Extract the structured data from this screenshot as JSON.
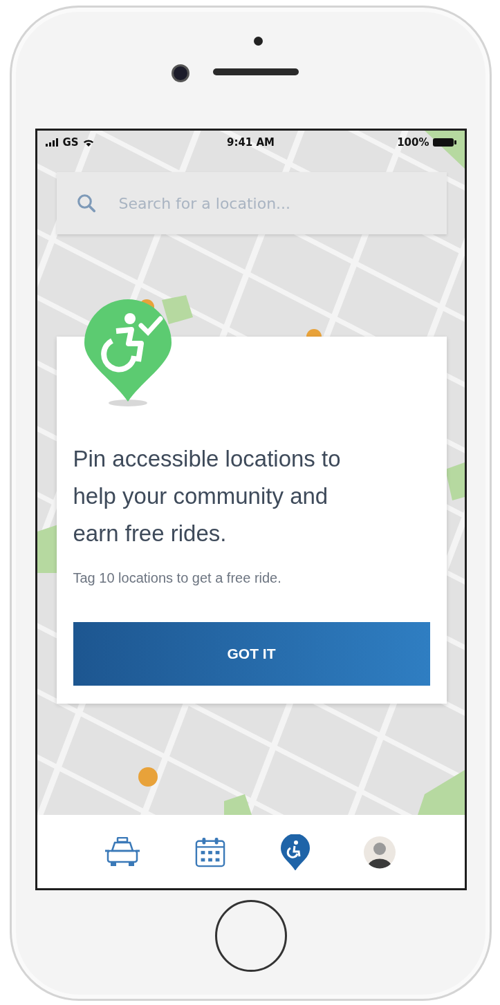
{
  "status_bar": {
    "carrier": "GS",
    "time": "9:41 AM",
    "battery": "100%"
  },
  "search": {
    "placeholder": "Search for a location..."
  },
  "card": {
    "title": "Pin accessible locations to help your community and earn free rides.",
    "subtitle": "Tag 10 locations to get a free ride.",
    "button": "GOT IT"
  },
  "nav": [
    {
      "kind": "car",
      "selected": false
    },
    {
      "kind": "calendar",
      "selected": false
    },
    {
      "kind": "pin",
      "selected": true
    },
    {
      "kind": "avatar",
      "selected": false
    }
  ]
}
